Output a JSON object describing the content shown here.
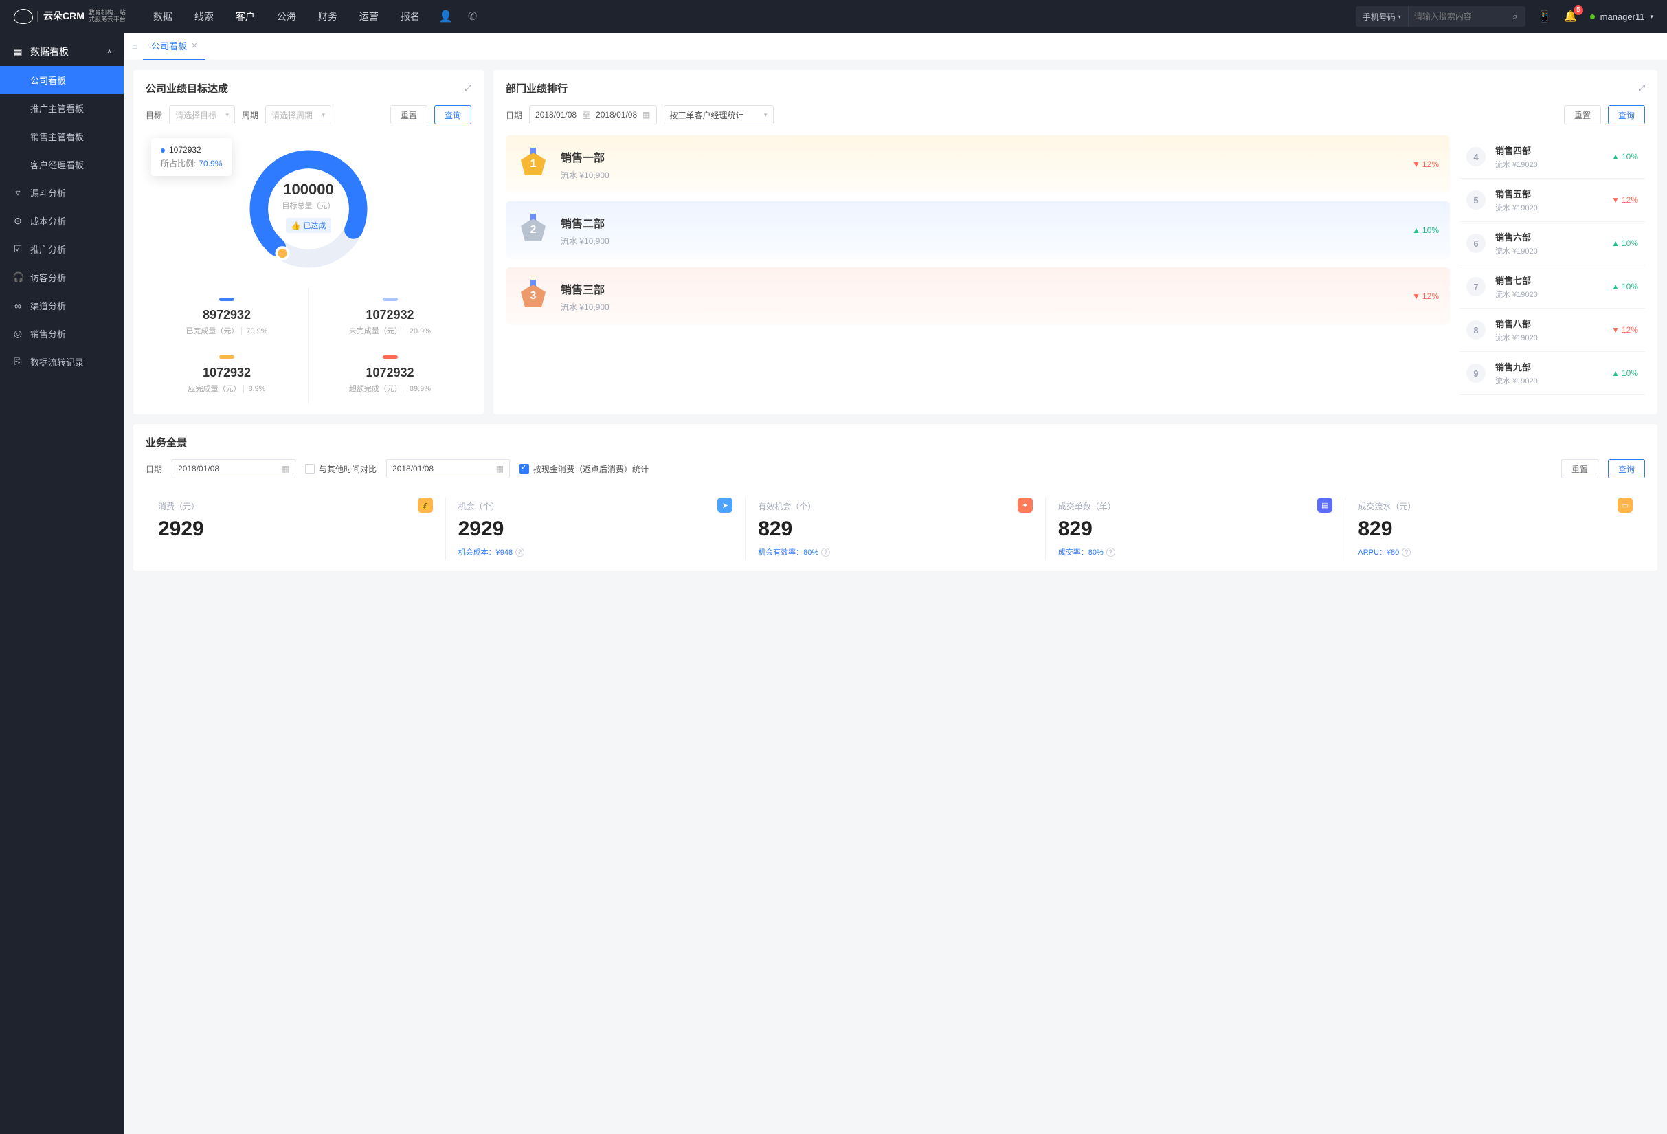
{
  "top": {
    "brand_main": "云朵CRM",
    "brand_sub1": "教育机构一站",
    "brand_sub2": "式服务云平台",
    "nav": [
      "数据",
      "线索",
      "客户",
      "公海",
      "财务",
      "运营",
      "报名"
    ],
    "nav_active": 2,
    "search_type": "手机号码",
    "search_placeholder": "请输入搜索内容",
    "badge": "5",
    "user": "manager11"
  },
  "sidebar": {
    "group": "数据看板",
    "subs": [
      "公司看板",
      "推广主管看板",
      "销售主管看板",
      "客户经理看板"
    ],
    "active_sub": 0,
    "items": [
      "漏斗分析",
      "成本分析",
      "推广分析",
      "访客分析",
      "渠道分析",
      "销售分析",
      "数据流转记录"
    ]
  },
  "tab": {
    "label": "公司看板"
  },
  "target_card": {
    "title": "公司业绩目标达成",
    "lbl_target": "目标",
    "ph_target": "请选择目标",
    "lbl_period": "周期",
    "ph_period": "请选择周期",
    "btn_reset": "重置",
    "btn_query": "查询",
    "tooltip_val": "1072932",
    "tooltip_lbl": "所占比例:",
    "tooltip_pct": "70.9%",
    "center_num": "100000",
    "center_sub": "目标总量（元）",
    "center_tag": "已达成",
    "metrics": [
      {
        "bar": "#3e7fff",
        "val": "8972932",
        "lab": "已完成量（元）",
        "pct": "70.9%"
      },
      {
        "bar": "#a9c8ff",
        "val": "1072932",
        "lab": "未完成量（元）",
        "pct": "20.9%"
      },
      {
        "bar": "#ffb547",
        "val": "1072932",
        "lab": "应完成量（元）",
        "pct": "8.9%"
      },
      {
        "bar": "#ff6a56",
        "val": "1072932",
        "lab": "超额完成（元）",
        "pct": "89.9%"
      }
    ]
  },
  "rank_card": {
    "title": "部门业绩排行",
    "lbl_date": "日期",
    "date_from": "2018/01/08",
    "date_sep": "至",
    "date_to": "2018/01/08",
    "sel_mode": "按工单客户经理统计",
    "btn_reset": "重置",
    "btn_query": "查询",
    "top3": [
      {
        "rank": "1",
        "name": "销售一部",
        "flow": "流水 ¥10,900",
        "dir": "down",
        "pct": "12%",
        "medal": "#f7b733"
      },
      {
        "rank": "2",
        "name": "销售二部",
        "flow": "流水 ¥10,900",
        "dir": "up",
        "pct": "10%",
        "medal": "#b9c2cf"
      },
      {
        "rank": "3",
        "name": "销售三部",
        "flow": "流水 ¥10,900",
        "dir": "down",
        "pct": "12%",
        "medal": "#ed9a6a"
      }
    ],
    "rest": [
      {
        "rank": "4",
        "name": "销售四部",
        "flow": "流水 ¥19020",
        "dir": "up",
        "pct": "10%"
      },
      {
        "rank": "5",
        "name": "销售五部",
        "flow": "流水 ¥19020",
        "dir": "down",
        "pct": "12%"
      },
      {
        "rank": "6",
        "name": "销售六部",
        "flow": "流水 ¥19020",
        "dir": "up",
        "pct": "10%"
      },
      {
        "rank": "7",
        "name": "销售七部",
        "flow": "流水 ¥19020",
        "dir": "up",
        "pct": "10%"
      },
      {
        "rank": "8",
        "name": "销售八部",
        "flow": "流水 ¥19020",
        "dir": "down",
        "pct": "12%"
      },
      {
        "rank": "9",
        "name": "销售九部",
        "flow": "流水 ¥19020",
        "dir": "up",
        "pct": "10%"
      }
    ]
  },
  "panorama": {
    "title": "业务全景",
    "lbl_date": "日期",
    "date1": "2018/01/08",
    "chk_compare": "与其他时间对比",
    "date2": "2018/01/08",
    "chk_cash": "按现金消费（返点后消费）统计",
    "btn_reset": "重置",
    "btn_query": "查询",
    "stats": [
      {
        "title": "消费（元）",
        "num": "2929",
        "sub": "",
        "icoClass": "ic1",
        "ico": "💰"
      },
      {
        "title": "机会（个）",
        "num": "2929",
        "sub": "机会成本：¥948",
        "icoClass": "ic2",
        "ico": "➤"
      },
      {
        "title": "有效机会（个）",
        "num": "829",
        "sub": "机会有效率：80%",
        "icoClass": "ic3",
        "ico": "✦"
      },
      {
        "title": "成交单数（单）",
        "num": "829",
        "sub": "成交率：80%",
        "icoClass": "ic4",
        "ico": "▤"
      },
      {
        "title": "成交流水（元）",
        "num": "829",
        "sub": "ARPU：¥80",
        "icoClass": "ic5",
        "ico": "▭"
      }
    ]
  },
  "chart_data": {
    "type": "pie",
    "title": "公司业绩目标达成",
    "total_label": "目标总量（元）",
    "total": 100000,
    "series": [
      {
        "name": "已完成量（元）",
        "value": 8972932,
        "pct": 70.9,
        "color": "#3e7fff"
      },
      {
        "name": "未完成量（元）",
        "value": 1072932,
        "pct": 20.9,
        "color": "#a9c8ff"
      },
      {
        "name": "应完成量（元）",
        "value": 1072932,
        "pct": 8.9,
        "color": "#ffb547"
      },
      {
        "name": "超额完成（元）",
        "value": 1072932,
        "pct": 89.9,
        "color": "#ff6a56"
      }
    ],
    "status": "已达成"
  }
}
